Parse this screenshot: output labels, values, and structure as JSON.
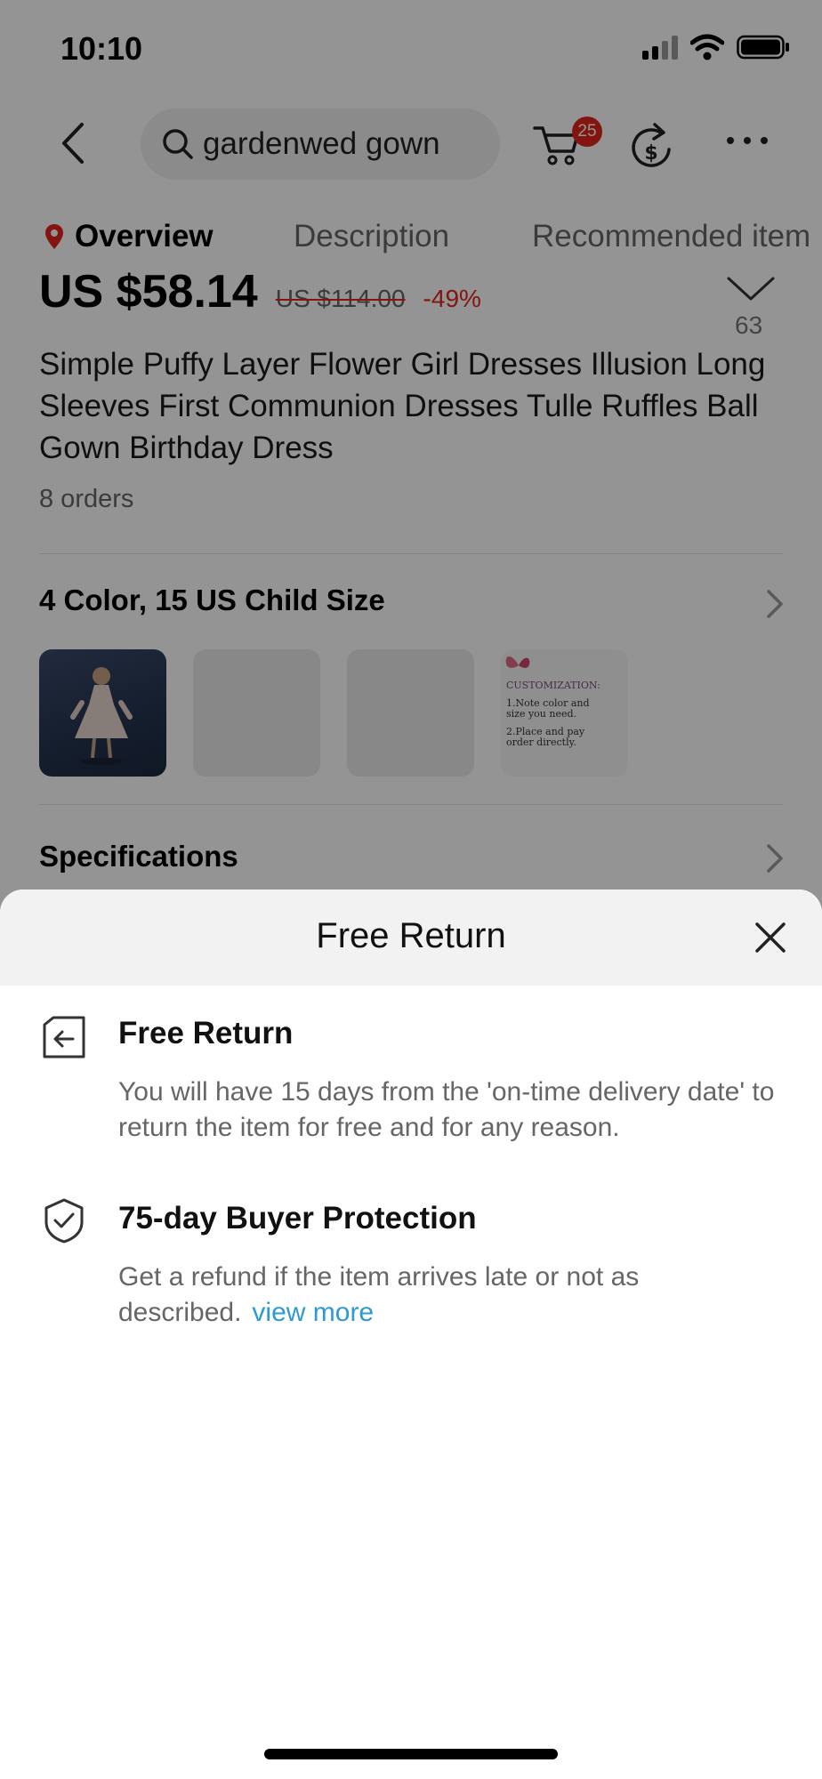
{
  "status_bar": {
    "time": "10:10"
  },
  "header": {
    "search_text": "gardenwed gown",
    "cart_count": "25"
  },
  "tabs": [
    {
      "label": "Overview"
    },
    {
      "label": "Description"
    },
    {
      "label": "Recommended item"
    }
  ],
  "product": {
    "price": "US $58.14",
    "original_price": "US $114.00",
    "discount": "-49%",
    "wishlist_count": "63",
    "title": "Simple Puffy Layer Flower Girl Dresses Illusion Long Sleeves First Communion Dresses Tulle Ruffles Ball Gown Birthday Dress",
    "orders": "8 orders"
  },
  "variants": {
    "title": "4 Color, 15 US Child Size",
    "customization_text": {
      "heading": "CUSTOMIZATION:",
      "line1": "1.Note color and",
      "line2": "size you need.",
      "line3": "2.Place and pay",
      "line4": "order directly."
    }
  },
  "specifications": {
    "title": "Specifications"
  },
  "sheet": {
    "title": "Free Return",
    "items": [
      {
        "icon": "return-box-icon",
        "title": "Free Return",
        "body": "You will have 15 days from the 'on-time delivery date' to return the item for free and for any reason."
      },
      {
        "icon": "shield-check-icon",
        "title": "75-day Buyer Protection",
        "body": "Get a refund if the item arrives late or not as described.",
        "link": "view more"
      }
    ]
  },
  "colors": {
    "accent_red": "#e1251b",
    "link_blue": "#2c9ad3"
  }
}
